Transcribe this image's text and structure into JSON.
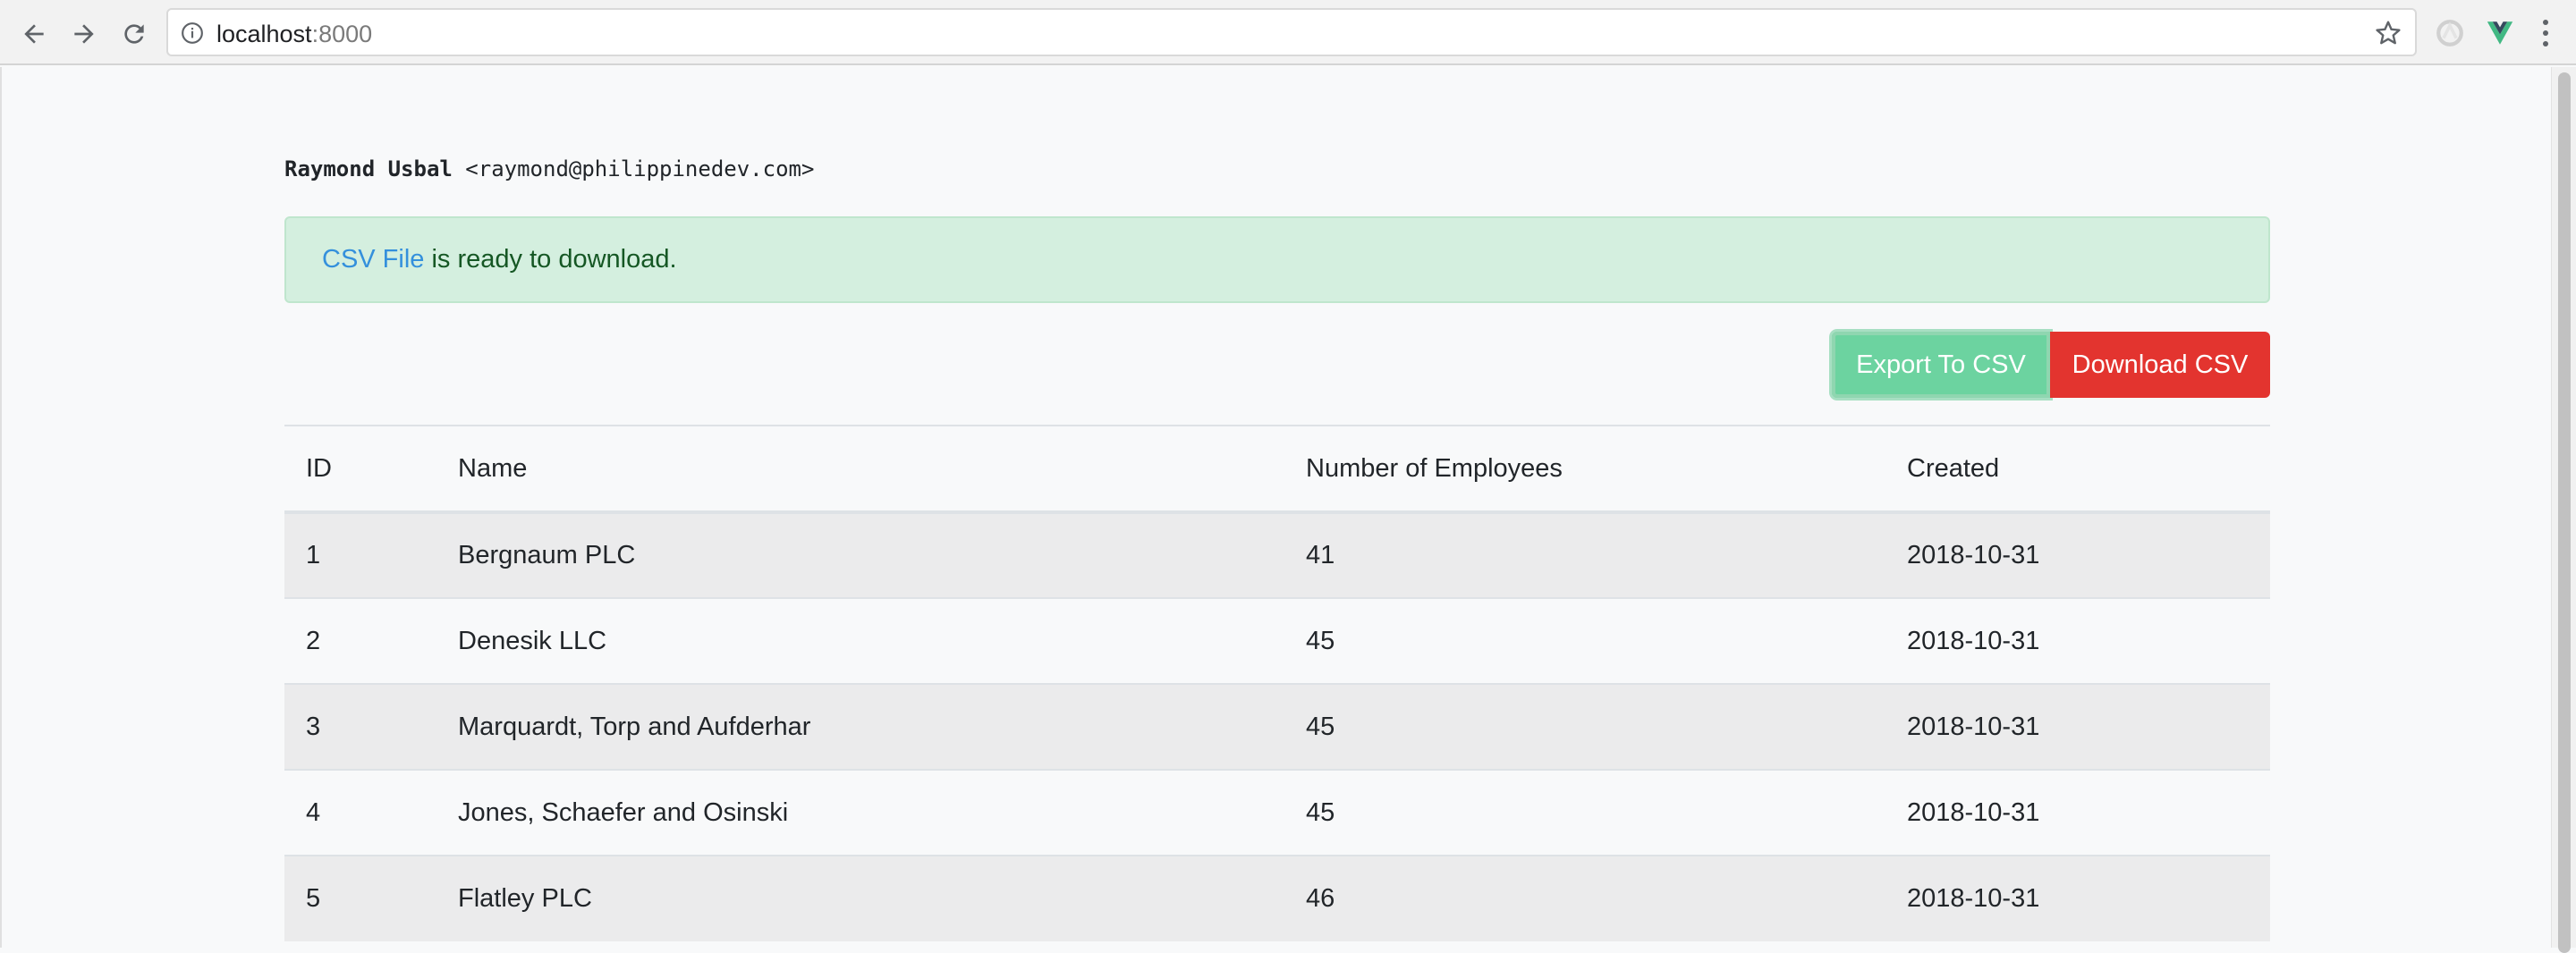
{
  "browser": {
    "url_host": "localhost",
    "url_port": ":8000"
  },
  "user": {
    "name": "Raymond Usbal",
    "email": "<raymond@philippinedev.com>"
  },
  "alert": {
    "link_text": "CSV File",
    "message": " is ready to download."
  },
  "actions": {
    "export_label": "Export To CSV",
    "download_label": "Download CSV"
  },
  "table": {
    "headers": [
      "ID",
      "Name",
      "Number of Employees",
      "Created"
    ],
    "rows": [
      [
        "1",
        "Bergnaum PLC",
        "41",
        "2018-10-31"
      ],
      [
        "2",
        "Denesik LLC",
        "45",
        "2018-10-31"
      ],
      [
        "3",
        "Marquardt, Torp and Aufderhar",
        "45",
        "2018-10-31"
      ],
      [
        "4",
        "Jones, Schaefer and Osinski",
        "45",
        "2018-10-31"
      ],
      [
        "5",
        "Flatley PLC",
        "46",
        "2018-10-31"
      ]
    ]
  },
  "icons": {
    "back": "arrow-left-icon",
    "forward": "arrow-right-icon",
    "reload": "reload-icon",
    "info": "info-icon",
    "bookmark": "star-icon",
    "extension_1": "extension-icon",
    "extension_2": "vue-devtools-icon",
    "menu": "more-vertical-icon"
  },
  "colors": {
    "export_button": "#6cd3a0",
    "download_button": "#e3342f",
    "alert_background": "#d4efdf",
    "link": "#3490dc"
  }
}
